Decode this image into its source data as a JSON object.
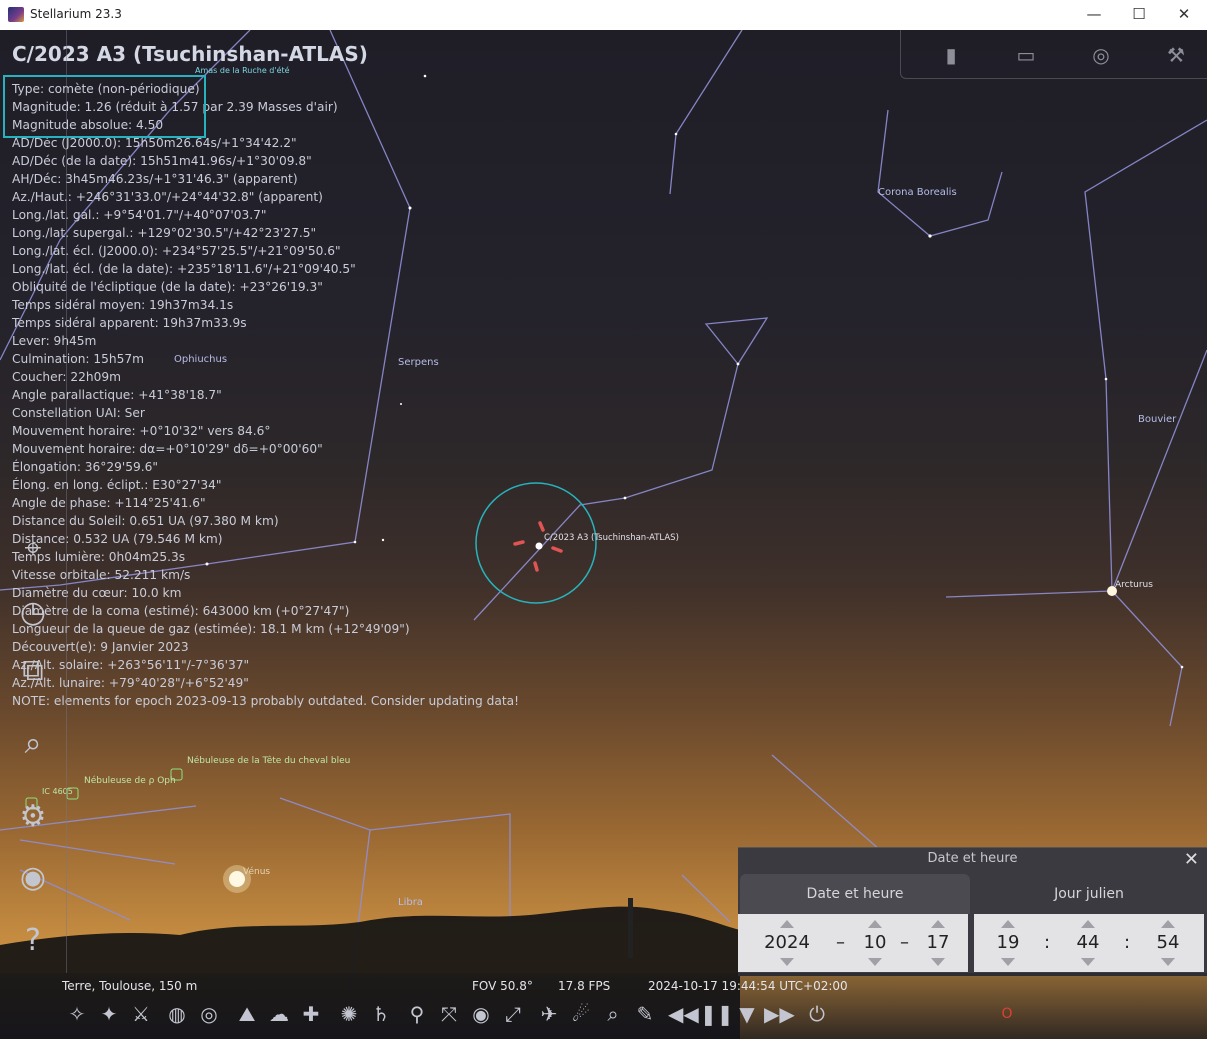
{
  "window": {
    "title": "Stellarium 23.3",
    "minimize": "—",
    "maximize": "☐",
    "close": "✕"
  },
  "object": {
    "title": "C/2023 A3 (Tsuchinshan-ATLAS)",
    "lines": [
      "Type: comète (non-périodique)",
      "Magnitude: 1.26 (réduit à 1.57 par 2.39 Masses d'air)",
      "Magnitude absolue: 4.50",
      "AD/Déc (J2000.0): 15h50m26.64s/+1°34'42.2\"",
      "AD/Déc (de la date): 15h51m41.96s/+1°30'09.8\"",
      "AH/Déc: 3h45m46.23s/+1°31'46.3\" (apparent)",
      "Az./Haut.: +246°31'33.0\"/+24°44'32.8\" (apparent)",
      "Long./lat. gal.: +9°54'01.7\"/+40°07'03.7\"",
      "Long./lat. supergal.: +129°02'30.5\"/+42°23'27.5\"",
      "Long./lat. écl. (J2000.0): +234°57'25.5\"/+21°09'50.6\"",
      "Long./lat. écl. (de la date): +235°18'11.6\"/+21°09'40.5\"",
      "Obliquité de l'écliptique (de la date): +23°26'19.3\"",
      "Temps sidéral moyen: 19h37m34.1s",
      "Temps sidéral apparent: 19h37m33.9s",
      "Lever: 9h45m",
      "Culmination: 15h57m",
      "Coucher: 22h09m",
      "Angle parallactique: +41°38'18.7\"",
      "Constellation UAI: Ser",
      "Mouvement horaire: +0°10'32\" vers 84.6°",
      "Mouvement horaire: dα=+0°10'29\" dδ=+0°00'60\"",
      "Élongation: 36°29'59.6\"",
      "Élong. en long. éclipt.: E30°27'34\"",
      "Angle de phase: +114°25'41.6\"",
      "Distance du Soleil: 0.651 UA (97.380 M km)",
      "Distance: 0.532 UA (79.546 M km)",
      "Temps lumière: 0h04m25.3s",
      "Vitesse orbitale: 52.211 km/s",
      "Diamètre du cœur: 10.0 km",
      "Diamètre de la coma (estimé): 643000 km (+0°27'47\")",
      "Longueur de la queue de gaz (estimée): 18.1 M km (+12°49'09\")",
      "Découvert(e): 9 Janvier 2023",
      "Az./Alt. solaire: +263°56'11\"/-7°36'37\"",
      "Az./Alt. lunaire: +79°40'28\"/+6°52'49\"",
      "NOTE: elements for epoch 2023-09-13 probably outdated. Consider updating data!"
    ]
  },
  "sky_labels": {
    "amas": "Amas de la Ruche d'été",
    "ophiuchus": "Ophiuchus",
    "serpens": "Serpens",
    "corona": "Corona Borealis",
    "bouvier": "Bouvier",
    "arcturus": "Arcturus",
    "comet": "C/2023 A3 (Tsuchinshan-ATLAS)",
    "neb_cheval": "Nébuleuse de la Tête du cheval bleu",
    "neb_oph": "Nébuleuse de ρ Oph",
    "ic4605": "IC 4605",
    "venus": "Vénus",
    "libra": "Libra"
  },
  "datetime_panel": {
    "header": "Date et heure",
    "tab_date": "Date et heure",
    "tab_julian": "Jour julien",
    "year": "2024",
    "month": "10",
    "day": "17",
    "hour": "19",
    "minute": "44",
    "second": "54",
    "date_sep": "–",
    "time_sep": ":"
  },
  "status_bar": {
    "location": "Terre, Toulouse, 150 m",
    "fov": "FOV 50.8°",
    "fps": "17.8 FPS",
    "datetime": "2024-10-17 19:44:54 UTC+02:00"
  },
  "colors": {
    "selection": "#27b3bd",
    "constellation_lines": "#8f8fd6",
    "sky_top": "#1f1e27",
    "horizon": "#d69c4c"
  },
  "icons": {
    "left": [
      "location-icon",
      "clock-icon",
      "view-icon",
      "search-icon",
      "settings-icon",
      "astrocalc-icon",
      "help-icon"
    ],
    "top": [
      "ocular-icon",
      "screen-icon",
      "target-icon",
      "wrench-icon"
    ],
    "bottom": [
      "constellation-lines-icon",
      "constellation-labels-icon",
      "constellation-art-icon",
      "equatorial-grid-icon",
      "azimuthal-grid-icon",
      "ground-icon",
      "atmosphere-icon",
      "cardinal-points-icon",
      "nebulae-icon",
      "planets-icon",
      "telescope-icon",
      "center-icon",
      "night-mode-icon",
      "fullscreen-icon",
      "satellites-icon",
      "meteors-icon",
      "search-sky-icon",
      "pointer-icon",
      "rewind-icon",
      "pause-icon",
      "realtime-icon",
      "forward-icon",
      "quit-icon"
    ]
  }
}
